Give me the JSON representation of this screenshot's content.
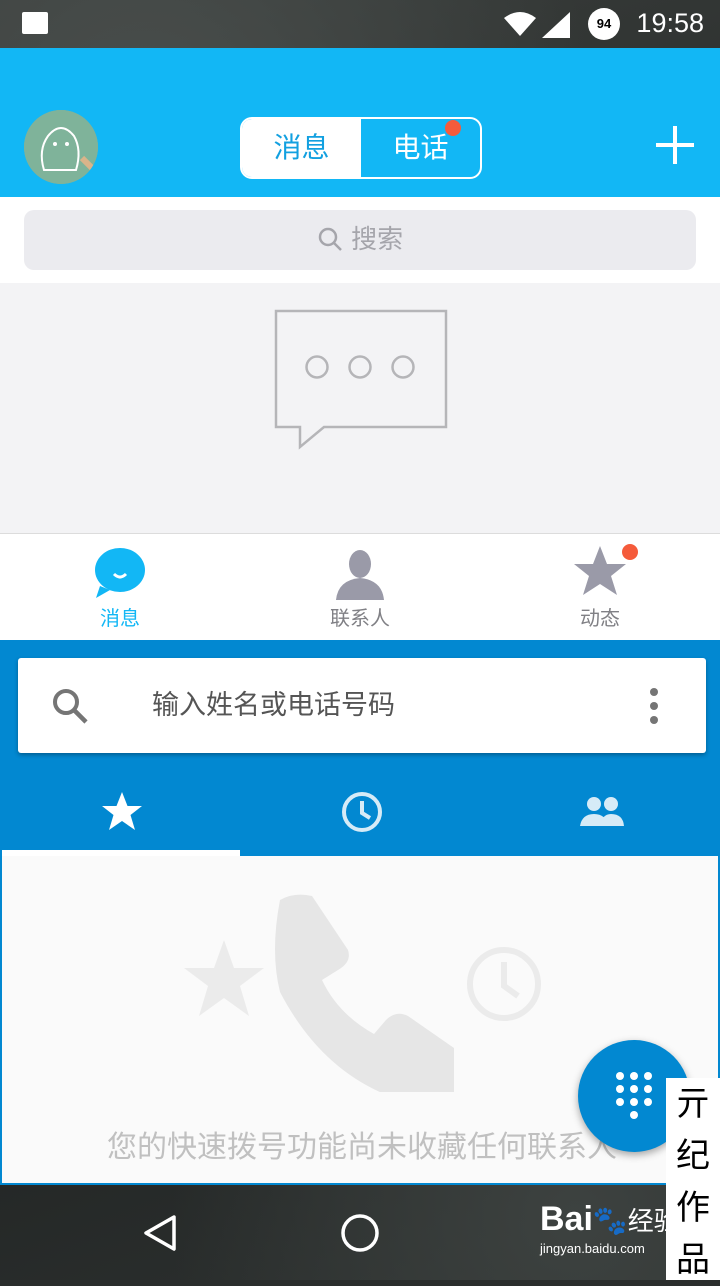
{
  "status_bar": {
    "time": "19:58",
    "battery": "94"
  },
  "qq": {
    "segments": {
      "messages": "消息",
      "calls": "电话"
    },
    "search_placeholder": "搜索",
    "bottom_tabs": [
      {
        "label": "消息",
        "active": true
      },
      {
        "label": "联系人",
        "active": false
      },
      {
        "label": "动态",
        "active": false
      }
    ],
    "colors": {
      "brand": "#12b7f5",
      "badge": "#f55b3b"
    }
  },
  "dialer": {
    "search_placeholder": "输入姓名或电话号码",
    "tabs": [
      "star-icon",
      "clock-icon",
      "people-icon"
    ],
    "empty_text": "您的快速拨号功能尚未收藏任何联系人",
    "colors": {
      "primary": "#0288d1"
    }
  },
  "watermark": {
    "vertical_text": "亓纪作品",
    "logo": "Bai",
    "logo2": "经验",
    "url": "jingyan.baidu.com"
  }
}
